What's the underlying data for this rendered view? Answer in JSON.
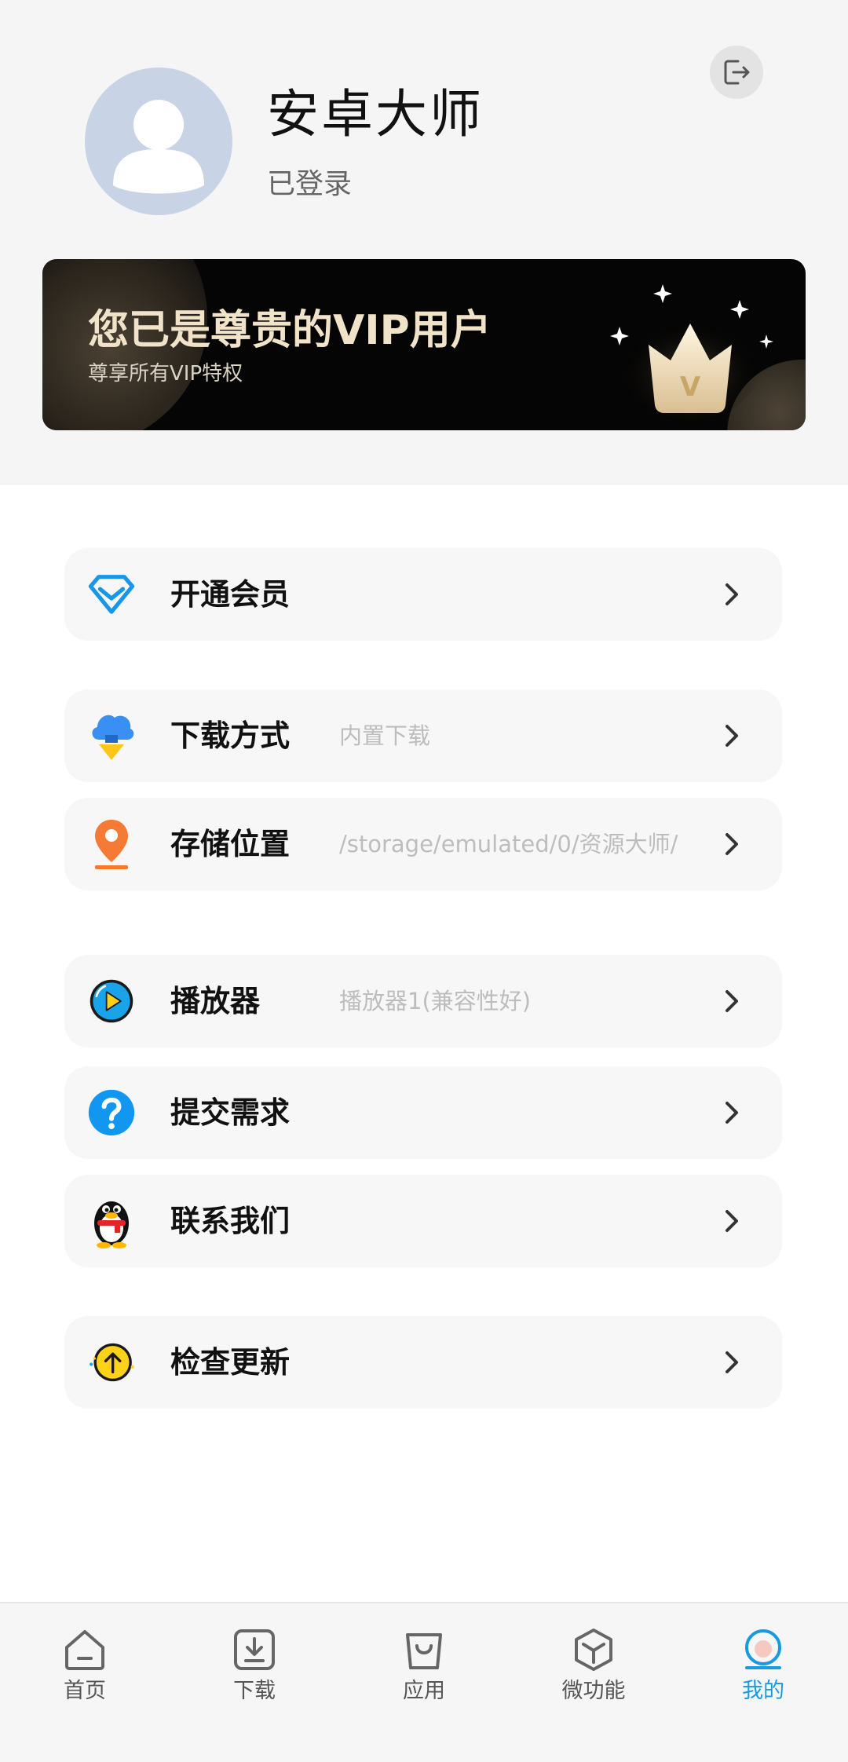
{
  "profile": {
    "username": "安卓大师",
    "status": "已登录"
  },
  "vip_banner": {
    "title": "您已是尊贵的VIP用户",
    "subtitle": "尊享所有VIP特权",
    "badge_letter": "V"
  },
  "menu": [
    {
      "label": "开通会员",
      "value": "",
      "icon": "diamond-icon"
    },
    {
      "label": "下载方式",
      "value": "内置下载",
      "icon": "cloud-download-icon"
    },
    {
      "label": "存储位置",
      "value": "/storage/emulated/0/资源大师/",
      "icon": "location-pin-icon"
    },
    {
      "label": "播放器",
      "value": "播放器1(兼容性好)",
      "icon": "play-icon"
    },
    {
      "label": "提交需求",
      "value": "",
      "icon": "question-icon"
    },
    {
      "label": "联系我们",
      "value": "",
      "icon": "qq-penguin-icon"
    },
    {
      "label": "检查更新",
      "value": "",
      "icon": "upgrade-arrow-icon"
    }
  ],
  "tabbar": {
    "items": [
      {
        "label": "首页",
        "icon": "home-icon"
      },
      {
        "label": "下载",
        "icon": "download-icon"
      },
      {
        "label": "应用",
        "icon": "shopping-bag-icon"
      },
      {
        "label": "微功能",
        "icon": "cube-icon"
      },
      {
        "label": "我的",
        "icon": "profile-icon"
      }
    ],
    "active_index": 4
  },
  "colors": {
    "accent": "#1a9ae0",
    "header_bg": "#f5f5f5",
    "vip_gold": "#f1e3c8",
    "menu_bg": "#f7f7f7"
  }
}
